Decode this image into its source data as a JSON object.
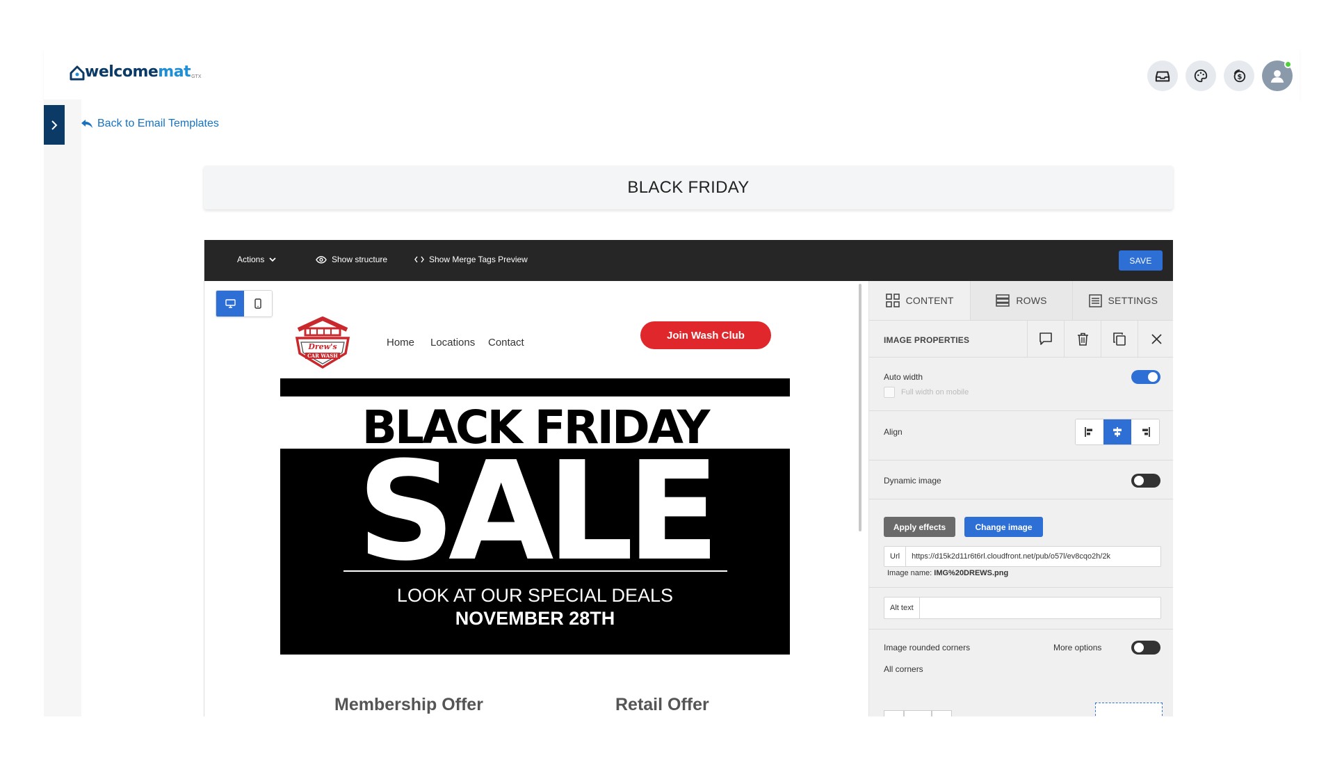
{
  "header": {
    "logo": {
      "part1": "welcome",
      "part2": "mat",
      "suffix": "GTX"
    },
    "icons": [
      "inbox-icon",
      "palette-icon",
      "billing-icon",
      "user-avatar-icon"
    ]
  },
  "nav": {
    "back_label": "Back to Email Templates"
  },
  "template": {
    "title": "BLACK FRIDAY"
  },
  "editor": {
    "toolbar": {
      "actions": "Actions",
      "show_structure": "Show structure",
      "show_merge_tags": "Show Merge Tags Preview",
      "save": "SAVE"
    }
  },
  "email": {
    "logo_text_top": "Drew's",
    "logo_text_bottom": "CAR WASH",
    "nav": [
      "Home",
      "Locations",
      "Contact"
    ],
    "cta": "Join Wash Club",
    "hero": {
      "line1": "BLACK FRIDAY",
      "line2": "SALE",
      "line3": "LOOK AT OUR SPECIAL DEALS",
      "line4": "NOVEMBER 28TH"
    },
    "offers": [
      "Membership Offer",
      "Retail Offer"
    ]
  },
  "panel": {
    "tabs": [
      {
        "label": "CONTENT",
        "icon": "grid-icon",
        "active": true
      },
      {
        "label": "ROWS",
        "icon": "rows-icon",
        "active": false
      },
      {
        "label": "SETTINGS",
        "icon": "settings-icon",
        "active": false
      }
    ],
    "section_title": "IMAGE PROPERTIES",
    "auto_width": {
      "label": "Auto width",
      "on": true
    },
    "full_width_mobile": {
      "label": "Full width on mobile",
      "checked": false
    },
    "align": {
      "label": "Align",
      "selected": "center"
    },
    "dynamic_image": {
      "label": "Dynamic image",
      "on": false
    },
    "apply_effects": "Apply effects",
    "change_image": "Change image",
    "url": {
      "label": "Url",
      "value": "https://d15k2d11r6t6rl.cloudfront.net/pub/o57l/ev8cqo2h/2k"
    },
    "image_name": {
      "label": "Image name:",
      "value": "IMG%20DREWS.png"
    },
    "alt_text": {
      "label": "Alt text",
      "value": ""
    },
    "rounded_corners": {
      "label": "Image rounded corners",
      "more_options": "More options",
      "on": false
    },
    "all_corners": "All corners"
  },
  "colors": {
    "brand_dark": "#0b3a66",
    "brand_light": "#1e8fd6",
    "accent_blue": "#2e6fd6",
    "cta_red": "#e0272b",
    "toolbar_bg": "#262626"
  }
}
